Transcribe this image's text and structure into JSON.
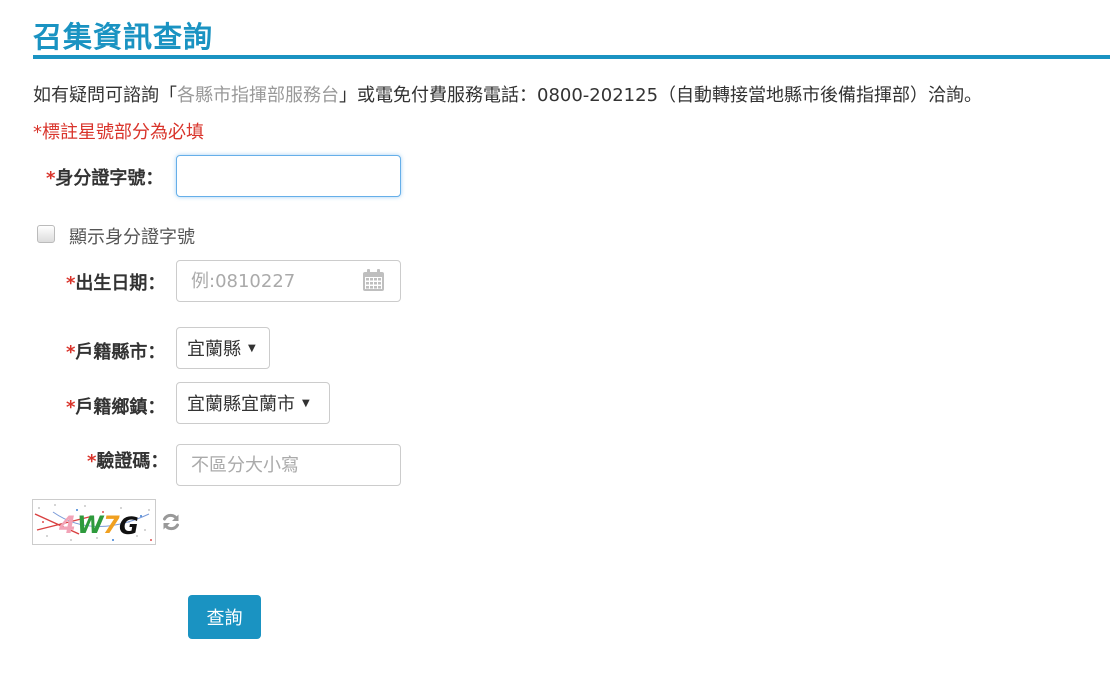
{
  "page": {
    "title": "召集資訊查詢"
  },
  "notice": {
    "prefix": "如有疑問可諮詢「",
    "link_text": "各縣市指揮部服務台",
    "suffix": "」或電免付費服務電話：0800-202125（自動轉接當地縣市後備指揮部）洽詢。"
  },
  "required_note": "*標註星號部分為必填",
  "form": {
    "id_number": {
      "star": "*",
      "label": "身分證字號：",
      "value": "",
      "placeholder": ""
    },
    "show_id": {
      "label": "顯示身分證字號",
      "checked": false
    },
    "birth_date": {
      "star": "*",
      "label": "出生日期：",
      "value": "",
      "placeholder": "例:0810227",
      "icon": "calendar-icon"
    },
    "county": {
      "star": "*",
      "label": "戶籍縣市：",
      "selected": "宜蘭縣"
    },
    "township": {
      "star": "*",
      "label": "戶籍鄉鎮：",
      "selected": "宜蘭縣宜蘭市"
    },
    "captcha_input": {
      "star": "*",
      "label": "驗證碼：",
      "value": "",
      "placeholder": "不區分大小寫"
    },
    "captcha": {
      "text": "4W7G",
      "refresh_icon": "refresh-icon"
    },
    "submit_label": "查詢"
  },
  "colors": {
    "accent": "#1a93c2",
    "required": "#d9342b",
    "link": "#999999"
  }
}
